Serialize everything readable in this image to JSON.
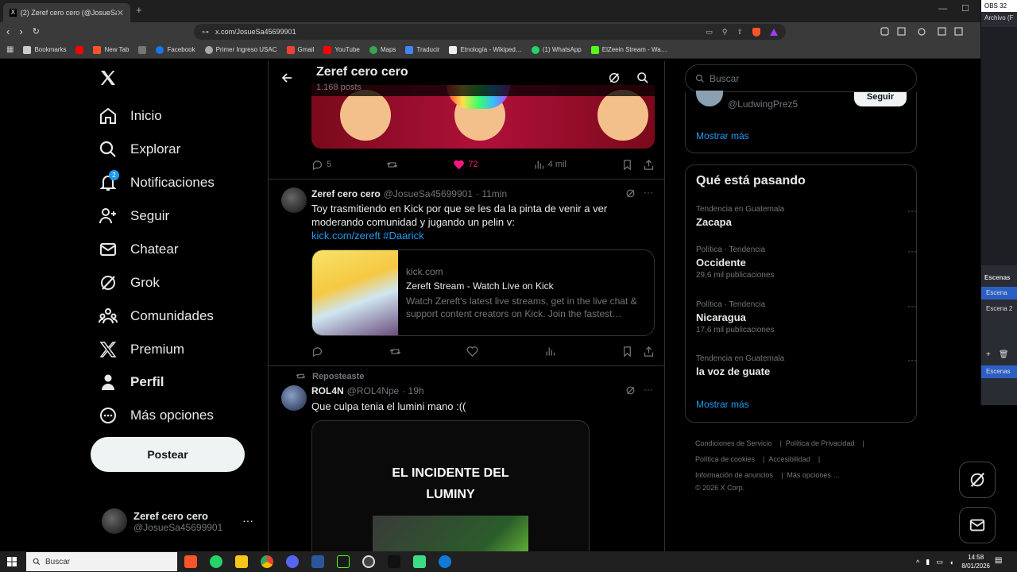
{
  "browser": {
    "tab_title": "(2) Zeref cero cero (@JosueSa4…",
    "url": "x.com/JosueSa45699901",
    "bookmarks": [
      "Bookmarks",
      "New Tab",
      "Facebook",
      "Primer Ingreso USAC",
      "Gmail",
      "YouTube",
      "Maps",
      "Traducir",
      "Etnología - Wikiped…",
      "(1) WhatsApp",
      "ElZeein Stream - Wa…"
    ]
  },
  "obs": {
    "title": "OBS 32",
    "menu": "Archivo (F",
    "scenes_header": "Escenas",
    "scenes": [
      "Escena",
      "Escena 2"
    ],
    "scene_bar": "Escenas"
  },
  "nav": {
    "items": [
      "Inicio",
      "Explorar",
      "Notificaciones",
      "Seguir",
      "Chatear",
      "Grok",
      "Comunidades",
      "Premium",
      "Perfil",
      "Más opciones"
    ],
    "notif_count": "2",
    "post_button": "Postear",
    "account_name": "Zeref cero cero",
    "account_handle": "@JosueSa45699901"
  },
  "profile": {
    "name": "Zeref cero cero",
    "posts": "1.168 posts"
  },
  "post1": {
    "replies": "5",
    "likes": "72",
    "views": "4 mil"
  },
  "post2": {
    "name": "Zeref cero cero",
    "handle": "@JosueSa45699901",
    "time": "· 11min",
    "text": "Toy trasmitiendo en Kick por que se les da la pinta de venir a ver moderando comunidad y jugando un pelin v:",
    "link": "kick.com/zereft #Daarick",
    "card_domain": "kick.com",
    "card_title": "Zereft Stream - Watch Live on Kick",
    "card_desc": "Watch Zereft's latest live streams, get in the live chat & support content creators on Kick. Join the fastest…"
  },
  "post3": {
    "repost_label": "Reposteaste",
    "name": "ROL4N",
    "handle": "@ROL4Npe",
    "time": "· 19h",
    "text": "Que culpa tenia el lumini mano :((",
    "media_title": "EL INCIDENTE DEL LUMINY"
  },
  "right": {
    "search_placeholder": "Buscar",
    "who_handle": "@LudwingPrez5",
    "follow_label": "Seguir",
    "show_more": "Mostrar más",
    "trends_title": "Qué está pasando",
    "trends": [
      {
        "context": "Tendencia en Guatemala",
        "topic": "Zacapa",
        "count": ""
      },
      {
        "context": "Política · Tendencia",
        "topic": "Occidente",
        "count": "29,6 mil publicaciones"
      },
      {
        "context": "Política · Tendencia",
        "topic": "Nicaragua",
        "count": "17,6 mil publicaciones"
      },
      {
        "context": "Tendencia en Guatemala",
        "topic": "la voz de guate",
        "count": ""
      }
    ],
    "trends_more": "Mostrar más",
    "footer_links": [
      "Condiciones de Servicio",
      "Política de Privacidad",
      "Política de cookies",
      "Accesibilidad",
      "Información de anuncios",
      "Más opciones …"
    ],
    "copyright": "© 2026 X Corp."
  },
  "taskbar": {
    "search": "Buscar",
    "time": "14:58",
    "date": "8/01/2026"
  }
}
